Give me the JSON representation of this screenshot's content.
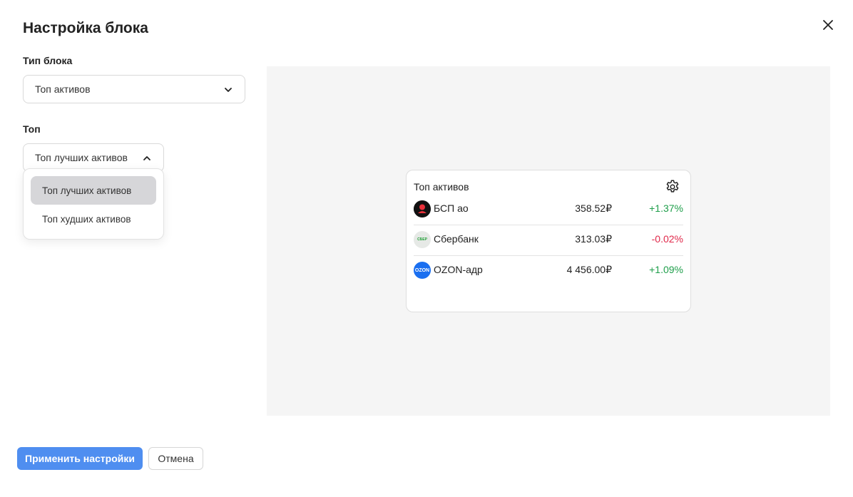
{
  "modal": {
    "title": "Настройка блока",
    "block_type": {
      "label": "Тип блока",
      "selected": "Топ активов"
    },
    "top": {
      "label": "Топ",
      "selected": "Топ лучших активов",
      "options": [
        "Топ лучших активов",
        "Топ худших активов"
      ]
    },
    "preview": {
      "card_title": "Топ активов",
      "rows": [
        {
          "name": "БСП ао",
          "price": "358.52₽",
          "change": "+1.37%",
          "logo": "bsp-logo",
          "logo_text": "",
          "change_color": "#1e9e4a"
        },
        {
          "name": "Сбербанк",
          "price": "313.03₽",
          "change": "-0.02%",
          "logo": "sber-logo",
          "logo_text": "СБЕР",
          "change_color": "#e0284a"
        },
        {
          "name": "OZON-адр",
          "price": "4 456.00₽",
          "change": "+1.09%",
          "logo": "ozon-logo",
          "logo_text": "OZON",
          "change_color": "#1e9e4a"
        }
      ]
    },
    "buttons": {
      "apply": "Применить настройки",
      "cancel": "Отмена"
    }
  },
  "colors": {
    "accent": "#4f8ef0",
    "positive": "#1e9e4a",
    "negative": "#e0284a",
    "preview_bg": "#f5f5f5"
  }
}
